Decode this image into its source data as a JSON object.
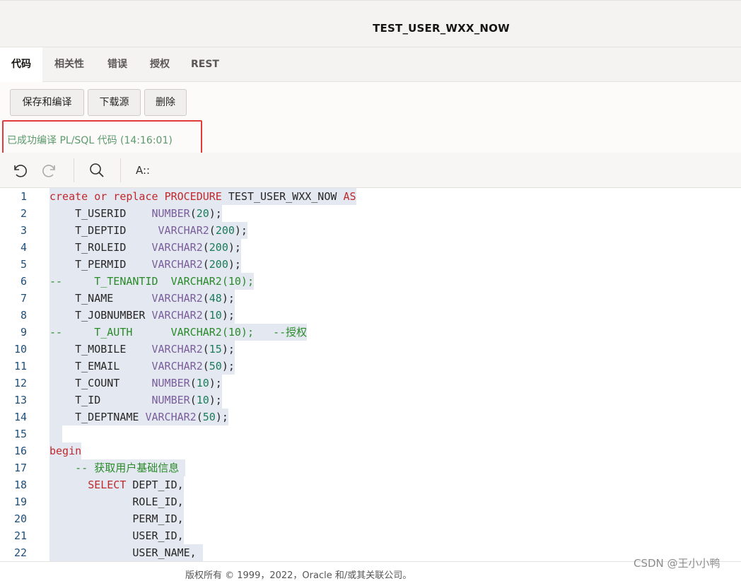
{
  "window": {
    "title": "TEST_USER_WXX_NOW"
  },
  "tabs": [
    {
      "label": "代码",
      "active": true
    },
    {
      "label": "相关性",
      "active": false
    },
    {
      "label": "错误",
      "active": false
    },
    {
      "label": "授权",
      "active": false
    },
    {
      "label": "REST",
      "active": false
    }
  ],
  "toolbar": {
    "save_compile_label": "保存和编译",
    "download_label": "下载源",
    "delete_label": "删除"
  },
  "status": {
    "message": "已成功编译 PL/SQL 代码 (14:16:01)",
    "color": "#5a9a6b"
  },
  "editor_tools": {
    "undo_icon": "undo-icon",
    "redo_icon": "redo-icon",
    "search_icon": "search-icon",
    "font_icon_label": "A::"
  },
  "code_lines": [
    {
      "n": "1",
      "tokens": [
        [
          "kw",
          "create or replace "
        ],
        [
          "kw",
          "PROCEDURE "
        ],
        [
          "",
          "TEST_USER_WXX_NOW "
        ],
        [
          "kw",
          "AS"
        ]
      ]
    },
    {
      "n": "2",
      "tokens": [
        [
          "",
          "    T_USERID    "
        ],
        [
          "ty",
          "NUMBER"
        ],
        [
          "",
          "("
        ],
        [
          "num",
          "20"
        ],
        [
          "",
          ");"
        ]
      ]
    },
    {
      "n": "3",
      "tokens": [
        [
          "",
          "    T_DEPTID     "
        ],
        [
          "ty",
          "VARCHAR2"
        ],
        [
          "",
          "("
        ],
        [
          "num",
          "200"
        ],
        [
          "",
          ");"
        ]
      ]
    },
    {
      "n": "4",
      "tokens": [
        [
          "",
          "    T_ROLEID    "
        ],
        [
          "ty",
          "VARCHAR2"
        ],
        [
          "",
          "("
        ],
        [
          "num",
          "200"
        ],
        [
          "",
          ");"
        ]
      ]
    },
    {
      "n": "5",
      "tokens": [
        [
          "",
          "    T_PERMID    "
        ],
        [
          "ty",
          "VARCHAR2"
        ],
        [
          "",
          "("
        ],
        [
          "num",
          "200"
        ],
        [
          "",
          ");"
        ]
      ]
    },
    {
      "n": "6",
      "tokens": [
        [
          "cm",
          "--     T_TENANTID  VARCHAR2(10);"
        ]
      ]
    },
    {
      "n": "7",
      "tokens": [
        [
          "",
          "    T_NAME      "
        ],
        [
          "ty",
          "VARCHAR2"
        ],
        [
          "",
          "("
        ],
        [
          "num",
          "48"
        ],
        [
          "",
          ");"
        ]
      ]
    },
    {
      "n": "8",
      "tokens": [
        [
          "",
          "    T_JOBNUMBER "
        ],
        [
          "ty",
          "VARCHAR2"
        ],
        [
          "",
          "("
        ],
        [
          "num",
          "10"
        ],
        [
          "",
          ");"
        ]
      ]
    },
    {
      "n": "9",
      "tokens": [
        [
          "cm",
          "--     T_AUTH      VARCHAR2(10);   --授权"
        ]
      ]
    },
    {
      "n": "10",
      "tokens": [
        [
          "",
          "    T_MOBILE    "
        ],
        [
          "ty",
          "VARCHAR2"
        ],
        [
          "",
          "("
        ],
        [
          "num",
          "15"
        ],
        [
          "",
          ");"
        ]
      ]
    },
    {
      "n": "11",
      "tokens": [
        [
          "",
          "    T_EMAIL     "
        ],
        [
          "ty",
          "VARCHAR2"
        ],
        [
          "",
          "("
        ],
        [
          "num",
          "50"
        ],
        [
          "",
          ");"
        ]
      ]
    },
    {
      "n": "12",
      "tokens": [
        [
          "",
          "    T_COUNT     "
        ],
        [
          "ty",
          "NUMBER"
        ],
        [
          "",
          "("
        ],
        [
          "num",
          "10"
        ],
        [
          "",
          ");"
        ]
      ]
    },
    {
      "n": "13",
      "tokens": [
        [
          "",
          "    T_ID        "
        ],
        [
          "ty",
          "NUMBER"
        ],
        [
          "",
          "("
        ],
        [
          "num",
          "10"
        ],
        [
          "",
          ");"
        ]
      ]
    },
    {
      "n": "14",
      "tokens": [
        [
          "",
          "    T_DEPTNAME "
        ],
        [
          "ty",
          "VARCHAR2"
        ],
        [
          "",
          "("
        ],
        [
          "num",
          "50"
        ],
        [
          "",
          ");"
        ]
      ]
    },
    {
      "n": "15",
      "tokens": [
        [
          "",
          "  "
        ]
      ]
    },
    {
      "n": "16",
      "tokens": [
        [
          "kw",
          "begin"
        ]
      ]
    },
    {
      "n": "17",
      "tokens": [
        [
          "cm",
          "    -- 获取用户基础信息 "
        ]
      ]
    },
    {
      "n": "18",
      "tokens": [
        [
          "",
          "      "
        ],
        [
          "kw",
          "SELECT "
        ],
        [
          "",
          "DEPT_ID,"
        ]
      ]
    },
    {
      "n": "19",
      "tokens": [
        [
          "",
          "             ROLE_ID,"
        ]
      ]
    },
    {
      "n": "20",
      "tokens": [
        [
          "",
          "             PERM_ID,"
        ]
      ]
    },
    {
      "n": "21",
      "tokens": [
        [
          "",
          "             USER_ID,"
        ]
      ]
    },
    {
      "n": "22",
      "tokens": [
        [
          "",
          "             USER_NAME, "
        ]
      ]
    }
  ],
  "footer": {
    "text": "版权所有 © 1999，2022，Oracle 和/或其关联公司。"
  },
  "watermark": "CSDN @王小小鸭"
}
